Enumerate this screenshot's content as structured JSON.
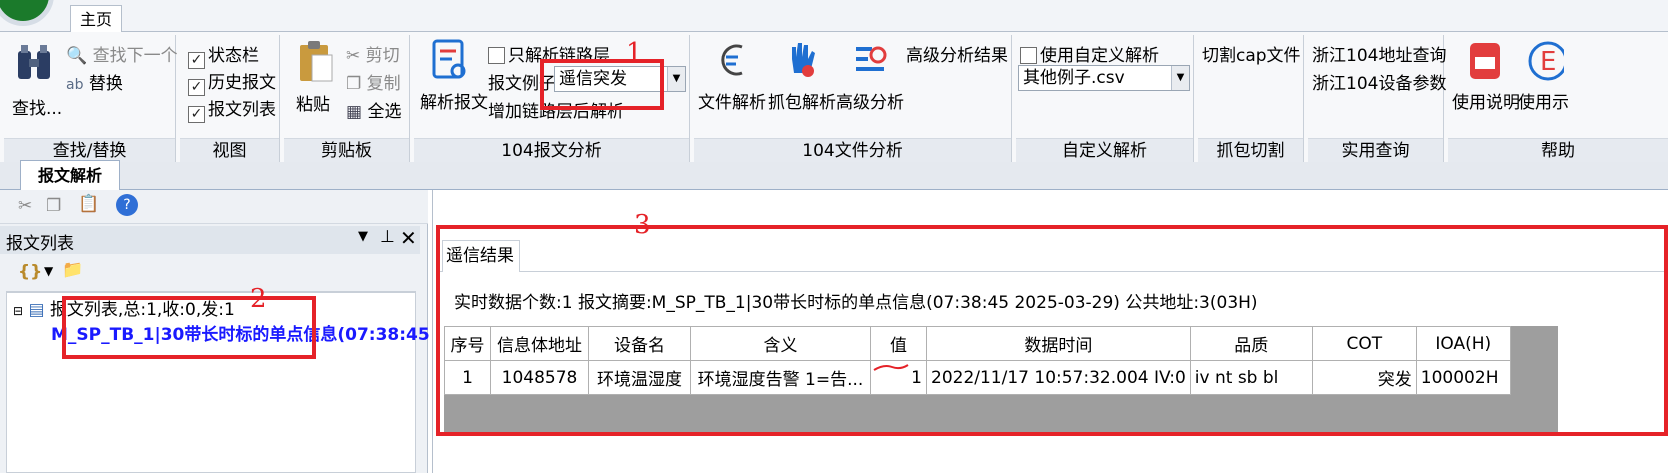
{
  "ribbon": {
    "main_tab": "主页",
    "groups": {
      "find": {
        "title": "查找/替换",
        "find": "查找...",
        "find_next": "查找下一个",
        "replace": "替换"
      },
      "view": {
        "title": "视图",
        "status_bar": "状态栏",
        "history": "历史报文",
        "msg_list": "报文列表"
      },
      "clipboard": {
        "title": "剪贴板",
        "paste": "粘贴",
        "cut": "剪切",
        "copy": "复制",
        "select_all": "全选"
      },
      "analysis104": {
        "title": "104报文分析",
        "parse": "解析报文",
        "only_link": "只解析链路层",
        "example_label": "报文例子",
        "example_value": "遥信突发",
        "add_link": "增加链路层后解析"
      },
      "file104": {
        "title": "104文件分析",
        "file_parse": "文件解析",
        "capture_parse": "抓包解析",
        "advanced": "高级分析",
        "advanced_result": "高级分析结果"
      },
      "custom": {
        "title": "自定义解析",
        "use_custom": "使用自定义解析",
        "csv_value": "其他例子.csv"
      },
      "capture": {
        "title": "抓包切割",
        "cut_cap": "切割cap文件"
      },
      "query": {
        "title": "实用查询",
        "addr_query": "浙江104地址查询",
        "dev_param": "浙江104设备参数"
      },
      "help": {
        "title": "帮助",
        "manual": "使用说明",
        "demo": "使用示"
      }
    }
  },
  "annotations": {
    "n1": "1",
    "n2": "2",
    "n3": "3"
  },
  "document": {
    "tab": "报文解析",
    "left": {
      "header": "报文列表",
      "tree_root": "报文列表,总:1,收:0,发:1",
      "tree_item": "M_SP_TB_1|30带长时标的单点信息(07:38:45"
    },
    "right": {
      "result_tab": "遥信结果",
      "summary": "实时数据个数:1  报文摘要:M_SP_TB_1|30带长时标的单点信息(07:38:45 2025-03-29)   公共地址:3(03H)",
      "columns": [
        "序号",
        "信息体地址",
        "设备名",
        "含义",
        "值",
        "数据时间",
        "品质",
        "COT",
        "IOA(H)"
      ],
      "rows": [
        [
          "1",
          "1048578",
          "环境温湿度",
          "环境湿度告警 1=告...",
          "1",
          "2022/11/17 10:57:32.004 IV:0",
          "iv nt sb bl",
          "突发",
          "100002H"
        ]
      ]
    }
  }
}
